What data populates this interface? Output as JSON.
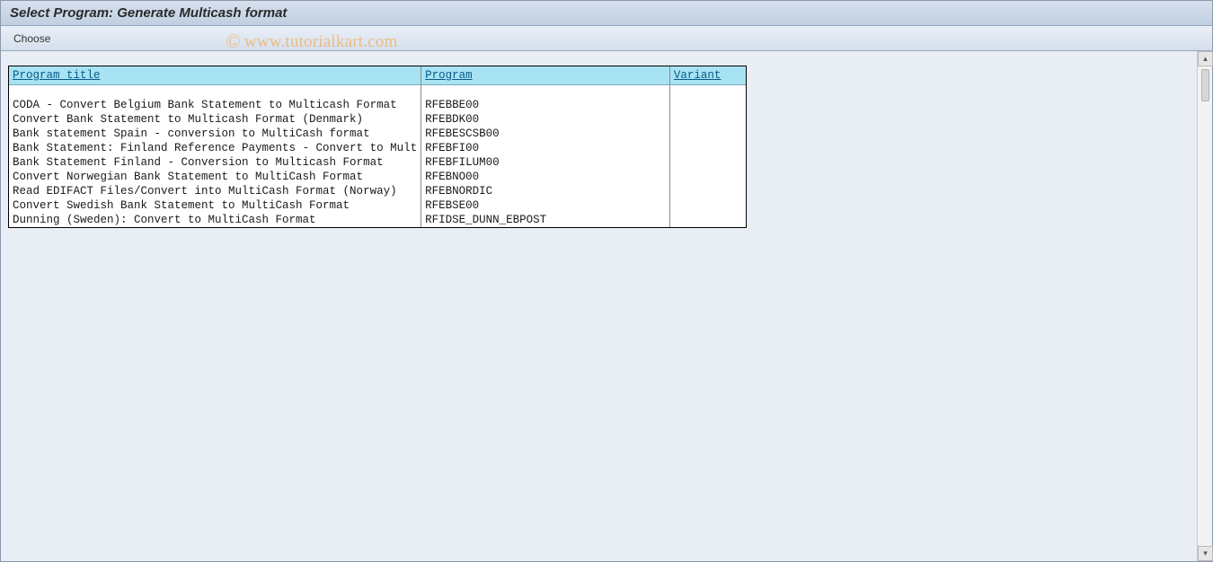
{
  "header": {
    "title": "Select Program: Generate Multicash format"
  },
  "toolbar": {
    "choose_label": "Choose"
  },
  "table": {
    "columns": {
      "title": "Program title",
      "program": "Program",
      "variant": "Variant"
    },
    "rows": [
      {
        "title": "CODA - Convert Belgium Bank Statement to Multicash Format",
        "program": "RFEBBE00",
        "variant": ""
      },
      {
        "title": "Convert Bank Statement to Multicash Format (Denmark)",
        "program": "RFEBDK00",
        "variant": ""
      },
      {
        "title": "Bank statement Spain - conversion to MultiCash format",
        "program": "RFEBESCSB00",
        "variant": ""
      },
      {
        "title": "Bank Statement: Finland Reference Payments - Convert to Mult",
        "program": "RFEBFI00",
        "variant": ""
      },
      {
        "title": "Bank Statement Finland - Conversion to Multicash Format",
        "program": "RFEBFILUM00",
        "variant": ""
      },
      {
        "title": "Convert Norwegian Bank Statement to MultiCash Format",
        "program": "RFEBNO00",
        "variant": ""
      },
      {
        "title": "Read EDIFACT Files/Convert into MultiCash Format (Norway)",
        "program": "RFEBNORDIC",
        "variant": ""
      },
      {
        "title": "Convert Swedish Bank Statement to MultiCash Format",
        "program": "RFEBSE00",
        "variant": ""
      },
      {
        "title": "Dunning (Sweden): Convert to MultiCash Format",
        "program": "RFIDSE_DUNN_EBPOST",
        "variant": ""
      }
    ]
  },
  "watermark": {
    "symbol": "©",
    "text": "www.tutorialkart.com"
  },
  "scroll": {
    "up": "▴",
    "down": "▾"
  }
}
